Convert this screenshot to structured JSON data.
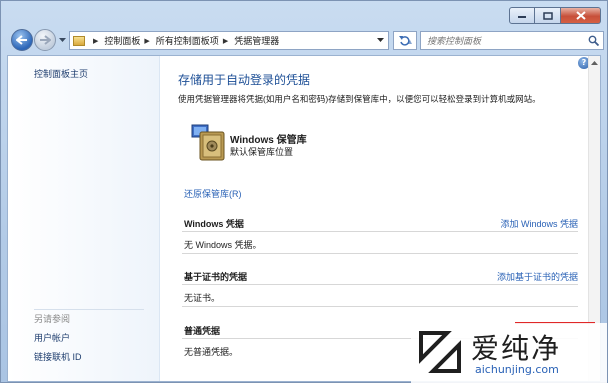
{
  "titlebar": {
    "buttons": [
      "minimize-icon",
      "maximize-icon",
      "close-icon"
    ]
  },
  "address_bar": {
    "crumbs": [
      "控制面板",
      "所有控制面板项",
      "凭据管理器"
    ]
  },
  "search": {
    "placeholder": "搜索控制面板"
  },
  "sidebar": {
    "home_link": "控制面板主页",
    "see_also_heading": "另请参阅",
    "links": [
      "用户帐户",
      "链接联机 ID"
    ]
  },
  "main": {
    "title": "存储用于自动登录的凭据",
    "description": "使用凭据管理器将凭据(如用户名和密码)存储到保管库中，以便您可以轻松登录到计算机或网站。",
    "vault": {
      "name": "Windows 保管库",
      "subtitle": "默认保管库位置"
    },
    "restore_link": "还原保管库(R)",
    "sections": [
      {
        "title": "Windows 凭据",
        "action": "添加 Windows 凭据",
        "empty": "无 Windows 凭据。"
      },
      {
        "title": "基于证书的凭据",
        "action": "添加基于证书的凭据",
        "empty": "无证书。"
      },
      {
        "title": "普通凭据",
        "action": "",
        "empty": "无普通凭据。"
      }
    ]
  },
  "watermark": {
    "name": "爱纯净",
    "url": "aichunjing.com"
  },
  "colors": {
    "link": "#2a62b6",
    "title": "#1d4f96",
    "highlight": "#e02828"
  }
}
